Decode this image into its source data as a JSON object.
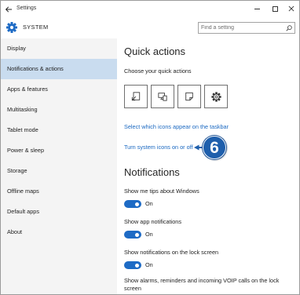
{
  "window": {
    "title": "Settings",
    "back_icon": "back-arrow-icon",
    "controls": {
      "minimize": "minimize-icon",
      "maximize": "maximize-icon",
      "close": "close-icon"
    }
  },
  "header": {
    "section_icon": "gear-icon",
    "section_title": "SYSTEM",
    "search": {
      "placeholder": "Find a setting",
      "value": "",
      "icon": "search-icon"
    }
  },
  "sidebar": {
    "selected_index": 1,
    "items": [
      {
        "label": "Display"
      },
      {
        "label": "Notifications & actions"
      },
      {
        "label": "Apps & features"
      },
      {
        "label": "Multitasking"
      },
      {
        "label": "Tablet mode"
      },
      {
        "label": "Power & sleep"
      },
      {
        "label": "Storage"
      },
      {
        "label": "Offline maps"
      },
      {
        "label": "Default apps"
      },
      {
        "label": "About"
      }
    ]
  },
  "main": {
    "quick_actions": {
      "heading": "Quick actions",
      "subheading": "Choose your quick actions",
      "tiles": [
        {
          "icon": "tablet-mode-icon"
        },
        {
          "icon": "connect-icon"
        },
        {
          "icon": "note-icon"
        },
        {
          "icon": "settings-icon"
        }
      ],
      "links": [
        "Select which icons appear on the taskbar",
        "Turn system icons on or off"
      ]
    },
    "notifications": {
      "heading": "Notifications",
      "settings": [
        {
          "label": "Show me tips about Windows",
          "state": "On",
          "on": true
        },
        {
          "label": "Show app notifications",
          "state": "On",
          "on": true
        },
        {
          "label": "Show notifications on the lock screen",
          "state": "On",
          "on": true
        },
        {
          "label": "Show alarms, reminders and incoming VOIP calls on the lock screen"
        }
      ]
    }
  },
  "callout": {
    "number": "6"
  },
  "colors": {
    "accent": "#1e6bc5",
    "link": "#1a68c1",
    "selected_item": "#c9dcef",
    "callout": "#1f5fac",
    "sidebar_background": "#f4f4f4"
  }
}
